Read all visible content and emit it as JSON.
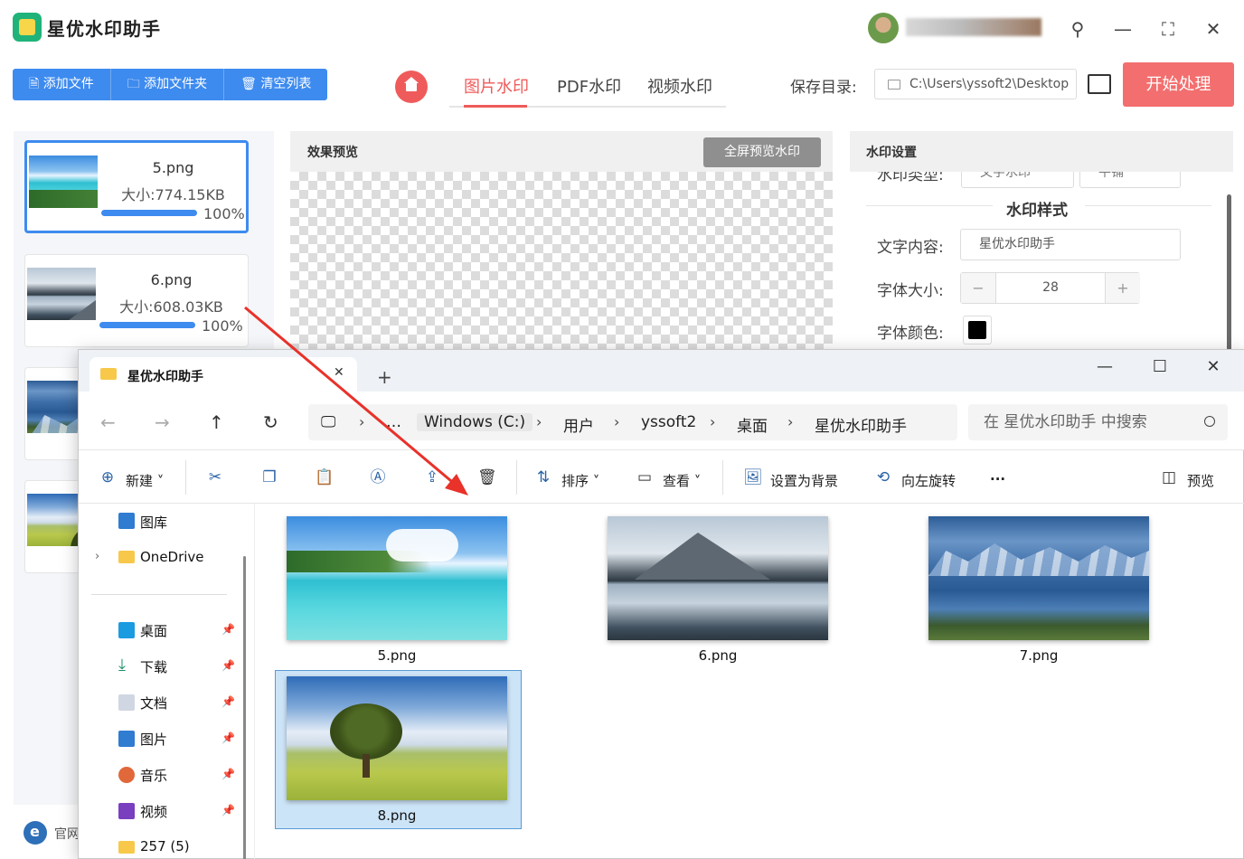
{
  "app": {
    "title": "星优水印助手",
    "toolbar": {
      "add_file": "添加文件",
      "add_folder": "添加文件夹",
      "clear_list": "清空列表"
    },
    "tabs": [
      "图片水印",
      "PDF水印",
      "视频水印"
    ],
    "save_label": "保存目录:",
    "save_path": "C:\\Users\\yssoft2\\Desktop",
    "start_button": "开始处理",
    "files": [
      {
        "name": "5.png",
        "size": "大小:774.15KB",
        "progress_text": "100%",
        "progress": 1.0
      },
      {
        "name": "6.png",
        "size": "大小:608.03KB",
        "progress_text": "100%",
        "progress": 1.0
      }
    ],
    "footer_text": "官网",
    "preview": {
      "title": "效果预览",
      "fullscreen_button": "全屏预览水印"
    },
    "settings": {
      "title": "水印设置",
      "type_label": "水印类型:",
      "type_value": "文字水印",
      "layout_value": "平铺",
      "section_title": "水印样式",
      "text_label": "文字内容:",
      "text_value": "星优水印助手",
      "size_label": "字体大小:",
      "size_value": "28",
      "color_label": "字体颜色:",
      "color_value": "#000000"
    }
  },
  "explorer": {
    "tab_title": "星优水印助手",
    "breadcrumb": [
      "Windows (C:)",
      "用户",
      "yssoft2",
      "桌面",
      "星优水印助手"
    ],
    "search_placeholder": "在 星优水印助手 中搜索",
    "commands": {
      "new": "新建",
      "sort": "排序",
      "view": "查看",
      "set_background": "设置为背景",
      "rotate_left": "向左旋转",
      "preview": "预览"
    },
    "nav": {
      "gallery": "图库",
      "onedrive": "OneDrive",
      "desktop": "桌面",
      "downloads": "下载",
      "documents": "文档",
      "pictures": "图片",
      "music": "音乐",
      "videos": "视频",
      "folder257": "257 (5)"
    },
    "files": [
      "5.png",
      "6.png",
      "7.png",
      "8.png"
    ],
    "selected_file": "8.png"
  },
  "colors": {
    "accent_blue": "#3e8bef",
    "accent_red": "#ef5b5b",
    "start_button": "#f36e6e",
    "arrow": "#e8322a",
    "selection": "#cce4f7"
  }
}
